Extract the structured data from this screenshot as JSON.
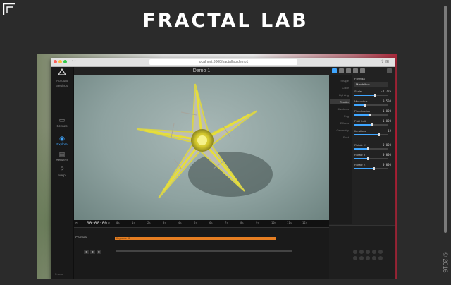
{
  "site": {
    "title": "FRACTAL LAB",
    "copyright": "© 2016"
  },
  "browser": {
    "url": "localhost:3000/fractallab/demo1"
  },
  "app": {
    "account": "Account",
    "settings": "Settings",
    "nav": [
      {
        "label": "Scenes",
        "icon": "film-icon"
      },
      {
        "label": "Explore",
        "icon": "eye-icon"
      },
      {
        "label": "Renders",
        "icon": "clapper-icon"
      },
      {
        "label": "Help",
        "icon": "help-icon"
      }
    ],
    "footer": "Fractal",
    "doc_title": "Demo 1"
  },
  "timeline": {
    "time": "00:00:00",
    "ticks": [
      "0s",
      "1s",
      "2s",
      "3s",
      "4s",
      "5s",
      "6s",
      "7s",
      "8s",
      "9s",
      "10s",
      "11s",
      "12s"
    ],
    "clip_label": "Camera",
    "track_label": "Keyframe 01"
  },
  "panel": {
    "categories": [
      "Shape",
      "Color",
      "Lighting",
      "Render",
      "Shadows",
      "Fog",
      "Effects",
      "Geometry",
      "Post"
    ],
    "active_category": "Shape",
    "formula_label": "Formula",
    "formula_value": "Mandelbox",
    "params": [
      {
        "label": "Scale",
        "value": "-1.726"
      },
      {
        "label": "Min radius",
        "value": "0.500"
      },
      {
        "label": "Fixed radius",
        "value": "1.000"
      },
      {
        "label": "Fold limit",
        "value": "1.000"
      },
      {
        "label": "Iterations",
        "value": "12"
      },
      {
        "label": "Rotate X",
        "value": "0.000"
      },
      {
        "label": "Rotate Y",
        "value": "0.000"
      },
      {
        "label": "Rotate Z",
        "value": "0.000"
      }
    ]
  }
}
